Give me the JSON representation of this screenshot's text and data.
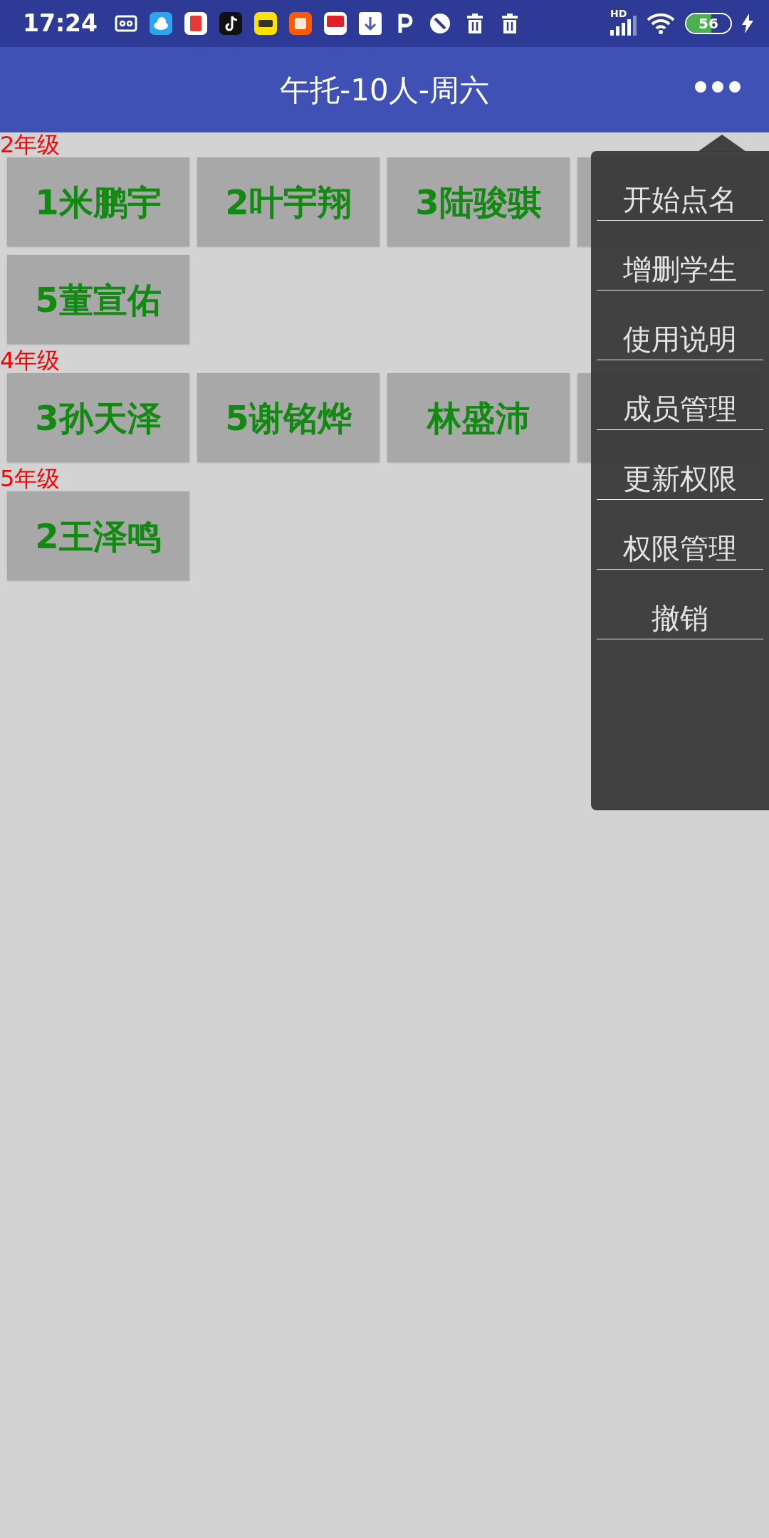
{
  "status_bar": {
    "time": "17:24",
    "battery": "56",
    "charging": true,
    "network": "HD"
  },
  "app_bar": {
    "title": "午托-10人-周六"
  },
  "groups": [
    {
      "grade": "2年级",
      "students": [
        {
          "kind": "name",
          "name": "1米鹏宇"
        },
        {
          "kind": "name",
          "name": "2叶宇翔"
        },
        {
          "kind": "name",
          "name": "3陆骏骐"
        },
        {
          "kind": "covered"
        },
        {
          "kind": "name",
          "name": "5董宣佑"
        }
      ]
    },
    {
      "grade": "4年级",
      "students": [
        {
          "kind": "name",
          "name": "3孙天泽"
        },
        {
          "kind": "name",
          "name": "5谢铭烨"
        },
        {
          "kind": "name",
          "name": "林盛沛"
        },
        {
          "kind": "covered"
        }
      ]
    },
    {
      "grade": "5年级",
      "students": [
        {
          "kind": "name",
          "name": "2王泽鸣"
        }
      ]
    }
  ],
  "menu": {
    "items": [
      "开始点名",
      "增删学生",
      "使用说明",
      "成员管理",
      "更新权限",
      "权限管理",
      "撤销"
    ]
  }
}
